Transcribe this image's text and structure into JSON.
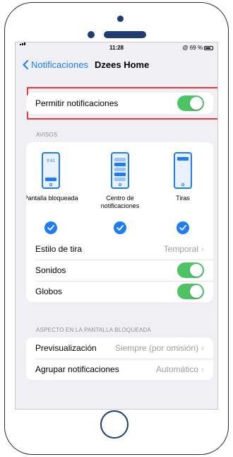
{
  "statusbar": {
    "time": "11:28",
    "battery": "@ 69 %"
  },
  "nav": {
    "back_label": "Notificaciones",
    "title": "Dzees Home"
  },
  "allow": {
    "label": "Permitir notificaciones",
    "enabled": true
  },
  "alerts": {
    "header": "AVISOS",
    "lock_clock": "9:41",
    "styles": [
      {
        "label": "Pantalla bloqueada",
        "checked": true
      },
      {
        "label": "Centro de notificaciones",
        "checked": true
      },
      {
        "label": "Tiras",
        "checked": true
      }
    ],
    "banner_style": {
      "label": "Estilo de tira",
      "value": "Temporal"
    },
    "sounds": {
      "label": "Sonidos",
      "enabled": true
    },
    "badges": {
      "label": "Globos",
      "enabled": true
    }
  },
  "lockscreen": {
    "header": "ASPECTO EN LA PANTALLA BLOQUEADA",
    "preview": {
      "label": "Previsualización",
      "value": "Siempre (por omisión)"
    },
    "grouping": {
      "label": "Agrupar notificaciones",
      "value": "Automático"
    }
  },
  "colors": {
    "accent": "#1d7cf6",
    "toggle_on": "#4cc466",
    "highlight": "#e83a3f",
    "device": "#1f3d6e"
  },
  "icons": [
    "chevron-left-icon",
    "chevron-right-icon",
    "checkmark-icon",
    "signal-icon",
    "battery-icon"
  ]
}
